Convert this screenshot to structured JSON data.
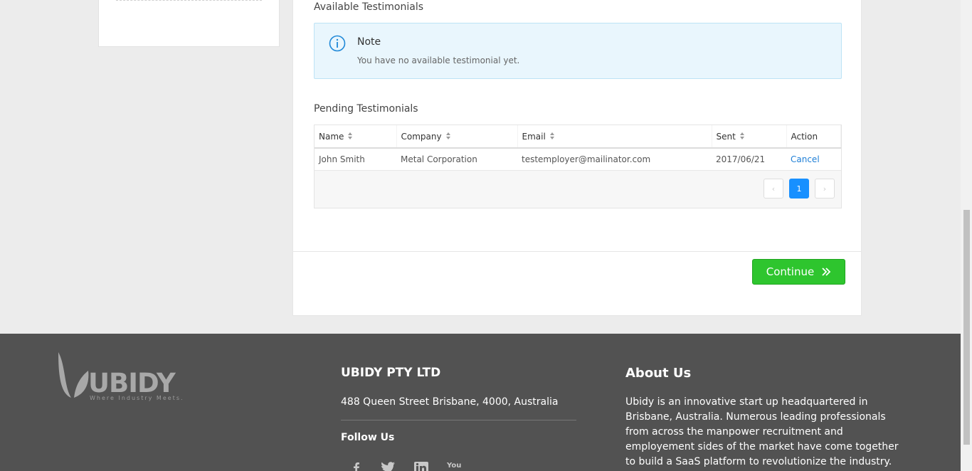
{
  "testimonials": {
    "available_title": "Available Testimonials",
    "note": {
      "title": "Note",
      "text": "You have no available testimonial yet.",
      "icon": "info-icon"
    },
    "pending_title": "Pending Testimonials",
    "columns": [
      "Name",
      "Company",
      "Email",
      "Sent",
      "Action"
    ],
    "rows": [
      {
        "name": "John Smith",
        "company": "Metal Corporation",
        "email": "testemployer@mailinator.com",
        "sent": "2017/06/21",
        "action": "Cancel"
      }
    ],
    "pagination": {
      "prev": "‹",
      "current": "1",
      "next": "›"
    }
  },
  "actions": {
    "continue_label": "Continue"
  },
  "footer": {
    "logo_text": "UBIDY",
    "logo_tagline": "Where Industry Meets.",
    "company_name": "UBIDY PTY LTD",
    "address": "488 Queen Street Brisbane, 4000, Australia",
    "follow_us": "Follow Us",
    "socials": [
      "facebook-icon",
      "twitter-icon",
      "linkedin-icon",
      "youtube-icon"
    ],
    "youtube_label": "You",
    "about_title": "About Us",
    "about_text": "Ubidy is an innovative start up headquartered in Brisbane, Australia. Numerous leading professionals from across the manpower recruitment and employement sides of the market have come together to build a SaaS platform to revolutionize the industry."
  },
  "colors": {
    "accent_blue": "#1890ff",
    "continue_green": "#2ec52e",
    "footer_bg": "#525252",
    "note_bg": "#e9f6fd"
  }
}
